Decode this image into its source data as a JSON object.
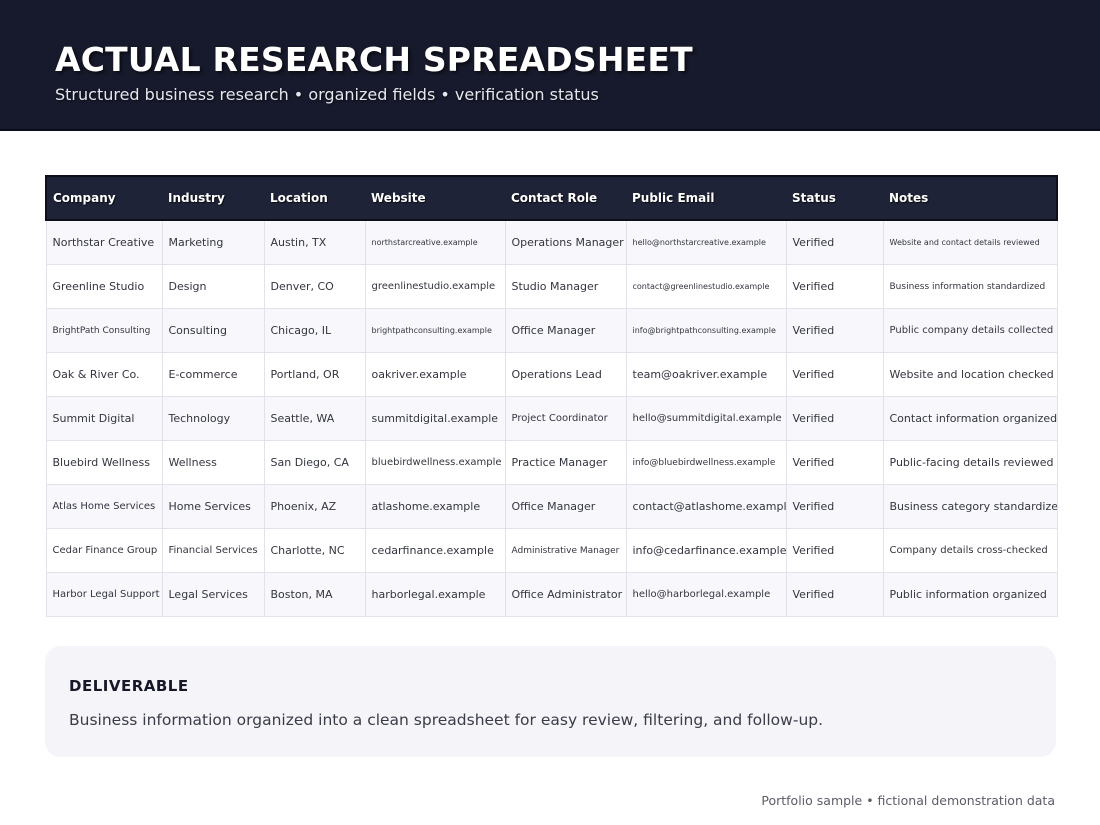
{
  "header": {
    "title": "ACTUAL RESEARCH SPREADSHEET",
    "subtitle": "Structured business research • organized fields • verification status"
  },
  "table": {
    "columns": [
      "Company",
      "Industry",
      "Location",
      "Website",
      "Contact Role",
      "Public Email",
      "Status",
      "Notes"
    ],
    "rows": [
      [
        "Northstar Creative",
        "Marketing",
        "Austin, TX",
        "northstarcreative.example",
        "Operations Manager",
        "hello@northstarcreative.example",
        "Verified",
        "Website and contact details reviewed"
      ],
      [
        "Greenline Studio",
        "Design",
        "Denver, CO",
        "greenlinestudio.example",
        "Studio Manager",
        "contact@greenlinestudio.example",
        "Verified",
        "Business information standardized"
      ],
      [
        "BrightPath Consulting",
        "Consulting",
        "Chicago, IL",
        "brightpathconsulting.example",
        "Office Manager",
        "info@brightpathconsulting.example",
        "Verified",
        "Public company details collected"
      ],
      [
        "Oak & River Co.",
        "E-commerce",
        "Portland, OR",
        "oakriver.example",
        "Operations Lead",
        "team@oakriver.example",
        "Verified",
        "Website and location checked"
      ],
      [
        "Summit Digital",
        "Technology",
        "Seattle, WA",
        "summitdigital.example",
        "Project Coordinator",
        "hello@summitdigital.example",
        "Verified",
        "Contact information organized"
      ],
      [
        "Bluebird Wellness",
        "Wellness",
        "San Diego, CA",
        "bluebirdwellness.example",
        "Practice Manager",
        "info@bluebirdwellness.example",
        "Verified",
        "Public-facing details reviewed"
      ],
      [
        "Atlas Home Services",
        "Home Services",
        "Phoenix, AZ",
        "atlashome.example",
        "Office Manager",
        "contact@atlashome.example",
        "Verified",
        "Business category standardized"
      ],
      [
        "Cedar Finance Group",
        "Financial Services",
        "Charlotte, NC",
        "cedarfinance.example",
        "Administrative Manager",
        "info@cedarfinance.example",
        "Verified",
        "Company details cross-checked"
      ],
      [
        "Harbor Legal Support",
        "Legal Services",
        "Boston, MA",
        "harborlegal.example",
        "Office Administrator",
        "hello@harborlegal.example",
        "Verified",
        "Public information organized"
      ]
    ]
  },
  "deliverable": {
    "title": "DELIVERABLE",
    "text": "Business information organized into a clean spreadsheet for easy review, filtering, and follow-up."
  },
  "footer": "Portfolio sample • fictional demonstration data"
}
